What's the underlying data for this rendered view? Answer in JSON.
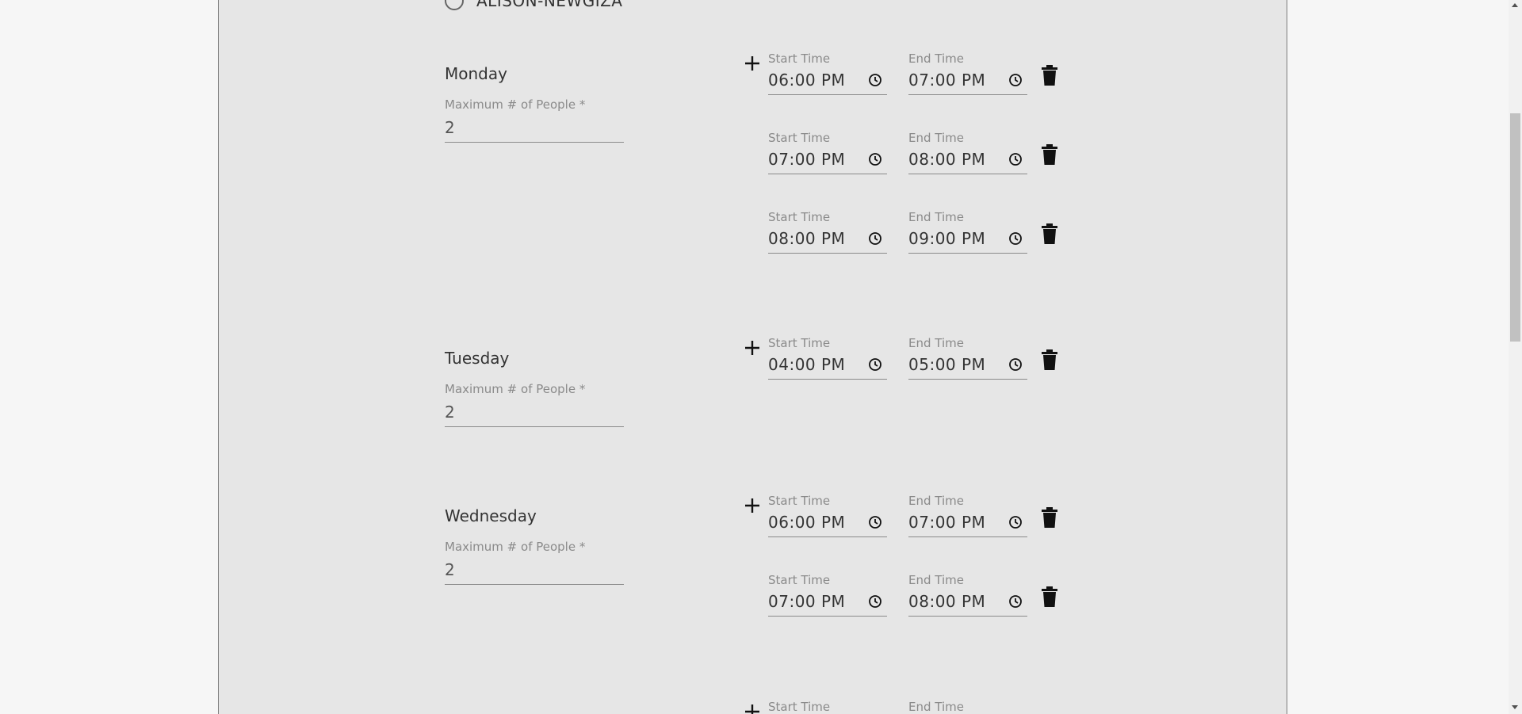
{
  "radio_option": {
    "label": "ALISON-NEWGIZA"
  },
  "days": [
    {
      "name": "Monday",
      "max_people_label": "Maximum # of People *",
      "max_people_value": "2",
      "slots": [
        {
          "start_label": "Start Time",
          "start_value": "06:00 PM",
          "end_label": "End Time",
          "end_value": "07:00 PM"
        },
        {
          "start_label": "Start Time",
          "start_value": "07:00 PM",
          "end_label": "End Time",
          "end_value": "08:00 PM"
        },
        {
          "start_label": "Start Time",
          "start_value": "08:00 PM",
          "end_label": "End Time",
          "end_value": "09:00 PM"
        }
      ]
    },
    {
      "name": "Tuesday",
      "max_people_label": "Maximum # of People *",
      "max_people_value": "2",
      "slots": [
        {
          "start_label": "Start Time",
          "start_value": "04:00 PM",
          "end_label": "End Time",
          "end_value": "05:00 PM"
        }
      ]
    },
    {
      "name": "Wednesday",
      "max_people_label": "Maximum # of People *",
      "max_people_value": "2",
      "slots": [
        {
          "start_label": "Start Time",
          "start_value": "06:00 PM",
          "end_label": "End Time",
          "end_value": "07:00 PM"
        },
        {
          "start_label": "Start Time",
          "start_value": "07:00 PM",
          "end_label": "End Time",
          "end_value": "08:00 PM"
        }
      ]
    },
    {
      "name": "",
      "slots": [
        {
          "start_label": "Start Time",
          "end_label": "End Time"
        }
      ]
    }
  ],
  "icons": {
    "add": "plus-icon",
    "clock": "clock-icon",
    "delete": "trash-icon"
  },
  "colors": {
    "panel_bg": "#e6e6e6",
    "page_bg": "#f6f6f6",
    "label": "#8a8a8a",
    "text": "#333333"
  }
}
